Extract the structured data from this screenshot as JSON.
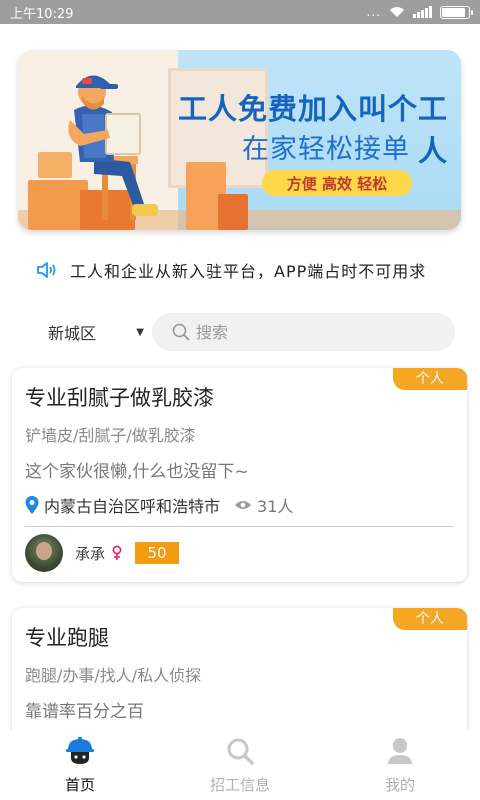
{
  "status_bar": {
    "time": "上午10:29",
    "dots": "...",
    "battery_level": 0.9
  },
  "banner": {
    "title": "工人免费加入叫个工人",
    "subtitle": "在家轻松接单",
    "tags": "方便 高效 轻松"
  },
  "notice": {
    "icon": "speaker-icon",
    "text": "工人和企业从新入驻平台，APP端占时不可用求"
  },
  "filter": {
    "area": "新城区",
    "caret": "▼",
    "search_placeholder": "搜索"
  },
  "cards": [
    {
      "tag": "个人",
      "title": "专业刮腻子做乳胶漆",
      "skills": "铲墙皮/刮腻子/做乳胶漆",
      "description": "这个家伙很懒,什么也没留下~",
      "location": "内蒙古自治区呼和浩特市",
      "views": "31人",
      "user_name": "承承",
      "gender": "female",
      "score": "50"
    },
    {
      "tag": "个人",
      "title": "专业跑腿",
      "skills": "跑腿/办事/找人/私人侦探",
      "description": "靠谱率百分之百"
    }
  ],
  "bottom_nav": [
    {
      "label": "首页",
      "icon": "worker-helmet-icon",
      "active": true
    },
    {
      "label": "招工信息",
      "icon": "search-icon",
      "active": false
    },
    {
      "label": "我的",
      "icon": "user-icon",
      "active": false
    }
  ],
  "colors": {
    "accent_orange": "#f5a623",
    "score_orange": "#f39c12",
    "location_blue": "#1e88e5",
    "banner_blue": "#1565c0"
  }
}
